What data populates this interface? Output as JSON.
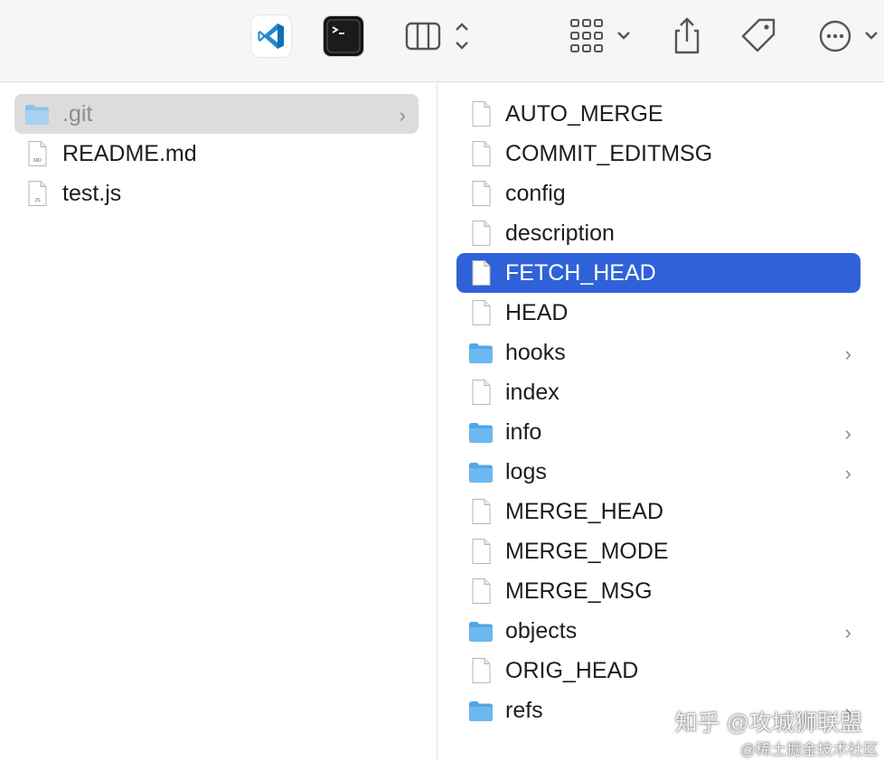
{
  "toolbar": {
    "icons": [
      "vscode-app-icon",
      "terminal-app-icon",
      "columns-view-icon",
      "group-icon",
      "share-icon",
      "tags-icon",
      "more-icon"
    ]
  },
  "colors": {
    "selection": "#2f62d8",
    "inactive_selection": "#dcdcdc",
    "folder": "#6cb8ef"
  },
  "left_column": {
    "items": [
      {
        "label": ".git",
        "type": "folder",
        "badge": "",
        "has_children": true,
        "selected": "inactive"
      },
      {
        "label": "README.md",
        "type": "file",
        "badge": "MD",
        "has_children": false,
        "selected": "none"
      },
      {
        "label": "test.js",
        "type": "file",
        "badge": "JS",
        "has_children": false,
        "selected": "none"
      }
    ]
  },
  "right_column": {
    "items": [
      {
        "label": "AUTO_MERGE",
        "type": "file",
        "has_children": false
      },
      {
        "label": "COMMIT_EDITMSG",
        "type": "file",
        "has_children": false
      },
      {
        "label": "config",
        "type": "file",
        "has_children": false
      },
      {
        "label": "description",
        "type": "file",
        "has_children": false
      },
      {
        "label": "FETCH_HEAD",
        "type": "file",
        "has_children": false,
        "selected": true
      },
      {
        "label": "HEAD",
        "type": "file",
        "has_children": false
      },
      {
        "label": "hooks",
        "type": "folder",
        "has_children": true
      },
      {
        "label": "index",
        "type": "file",
        "has_children": false
      },
      {
        "label": "info",
        "type": "folder",
        "has_children": true
      },
      {
        "label": "logs",
        "type": "folder",
        "has_children": true
      },
      {
        "label": "MERGE_HEAD",
        "type": "file",
        "has_children": false
      },
      {
        "label": "MERGE_MODE",
        "type": "file",
        "has_children": false
      },
      {
        "label": "MERGE_MSG",
        "type": "file",
        "has_children": false
      },
      {
        "label": "objects",
        "type": "folder",
        "has_children": true
      },
      {
        "label": "ORIG_HEAD",
        "type": "file",
        "has_children": false
      },
      {
        "label": "refs",
        "type": "folder",
        "has_children": true
      }
    ]
  },
  "watermark": {
    "line1": "知乎 @攻城狮联盟",
    "line2": "@稀土掘金技术社区"
  }
}
